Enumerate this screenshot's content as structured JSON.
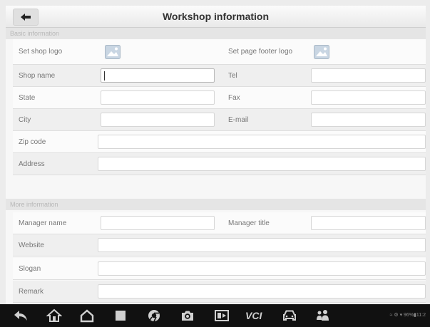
{
  "header": {
    "title": "Workshop information"
  },
  "sections": {
    "basic": "Basic information",
    "more": "More information"
  },
  "basic": {
    "shop_logo_label": "Set shop logo",
    "footer_logo_label": "Set page footer logo",
    "shop_name": {
      "label": "Shop name",
      "value": ""
    },
    "tel": {
      "label": "Tel",
      "value": ""
    },
    "state": {
      "label": "State",
      "value": ""
    },
    "fax": {
      "label": "Fax",
      "value": ""
    },
    "city": {
      "label": "City",
      "value": ""
    },
    "email": {
      "label": "E-mail",
      "value": ""
    },
    "zip": {
      "label": "Zip code",
      "value": ""
    },
    "address": {
      "label": "Address",
      "value": ""
    }
  },
  "more": {
    "manager_name": {
      "label": "Manager name",
      "value": ""
    },
    "manager_title": {
      "label": "Manager title",
      "value": ""
    },
    "website": {
      "label": "Website",
      "value": ""
    },
    "slogan": {
      "label": "Slogan",
      "value": ""
    },
    "remark": {
      "label": "Remark",
      "value": ""
    }
  },
  "navbar": {
    "icons": [
      "back-icon",
      "home-icon",
      "house-icon",
      "stop-icon",
      "chrome-icon",
      "camera-icon",
      "screen-record-icon",
      "vci-icon",
      "car-icon",
      "people-icon"
    ],
    "vci_label": "VCI",
    "status_text": "≈ ⚙ ▾ 96%▮11:2"
  },
  "colors": {
    "navbar": "#111111",
    "section_header": "#e5e5e5",
    "row_shaded": "#efefef"
  }
}
